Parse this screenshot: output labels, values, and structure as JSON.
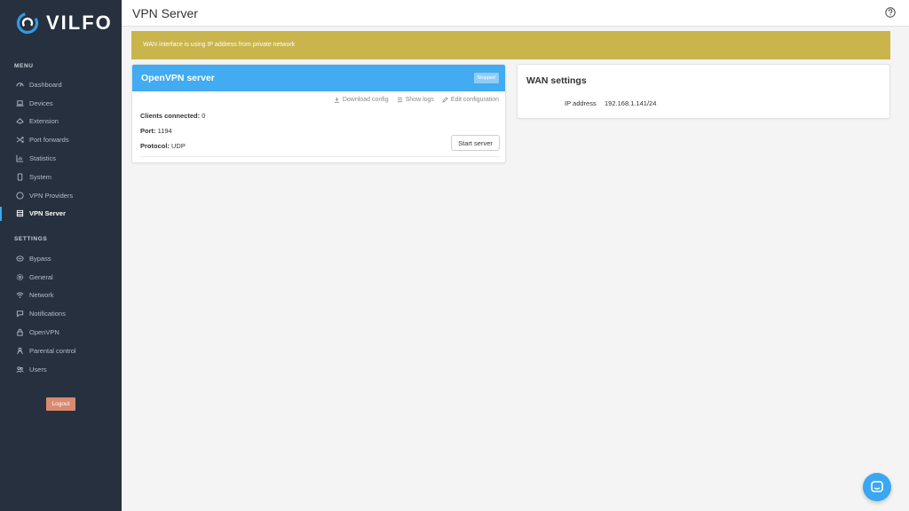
{
  "brand": {
    "name": "VILFO",
    "accent": "#3ba7f0"
  },
  "sidebar": {
    "menu_title": "MENU",
    "menu_items": [
      {
        "label": "Dashboard",
        "icon": "dashboard-icon"
      },
      {
        "label": "Devices",
        "icon": "laptop-icon"
      },
      {
        "label": "Extension",
        "icon": "extension-icon"
      },
      {
        "label": "Port forwards",
        "icon": "shuffle-icon"
      },
      {
        "label": "Statistics",
        "icon": "bar-chart-icon"
      },
      {
        "label": "System",
        "icon": "system-icon"
      },
      {
        "label": "VPN Providers",
        "icon": "globe-icon"
      },
      {
        "label": "VPN Server",
        "icon": "server-icon",
        "active": true
      }
    ],
    "settings_title": "SETTINGS",
    "settings_items": [
      {
        "label": "Bypass",
        "icon": "bypass-icon"
      },
      {
        "label": "General",
        "icon": "gear-icon"
      },
      {
        "label": "Network",
        "icon": "wifi-icon"
      },
      {
        "label": "Notifications",
        "icon": "chat-bubble-icon"
      },
      {
        "label": "OpenVPN",
        "icon": "lock-icon"
      },
      {
        "label": "Parental control",
        "icon": "parental-icon"
      },
      {
        "label": "Users",
        "icon": "users-icon"
      }
    ],
    "logout_label": "Logout",
    "logout_color": "#d98a72"
  },
  "header": {
    "title": "VPN Server",
    "help_icon": "help-circle-icon"
  },
  "alert": {
    "text": "WAN interface is using IP address from private network",
    "color": "#c9b54b"
  },
  "openvpn": {
    "title": "OpenVPN server",
    "status": "Stopped",
    "header_color": "#42abf1",
    "actions": [
      {
        "label": "Download config",
        "icon": "download-icon"
      },
      {
        "label": "Show logs",
        "icon": "list-icon"
      },
      {
        "label": "Edit configuration",
        "icon": "edit-icon"
      }
    ],
    "clients_label": "Clients connected:",
    "clients_value": "0",
    "port_label": "Port:",
    "port_value": "1194",
    "protocol_label": "Protocol:",
    "protocol_value": "UDP",
    "start_label": "Start server"
  },
  "wan": {
    "title": "WAN settings",
    "ip_label": "IP address",
    "ip_value": "192.168.1.141/24"
  },
  "chat": {
    "icon": "chat-icon"
  }
}
